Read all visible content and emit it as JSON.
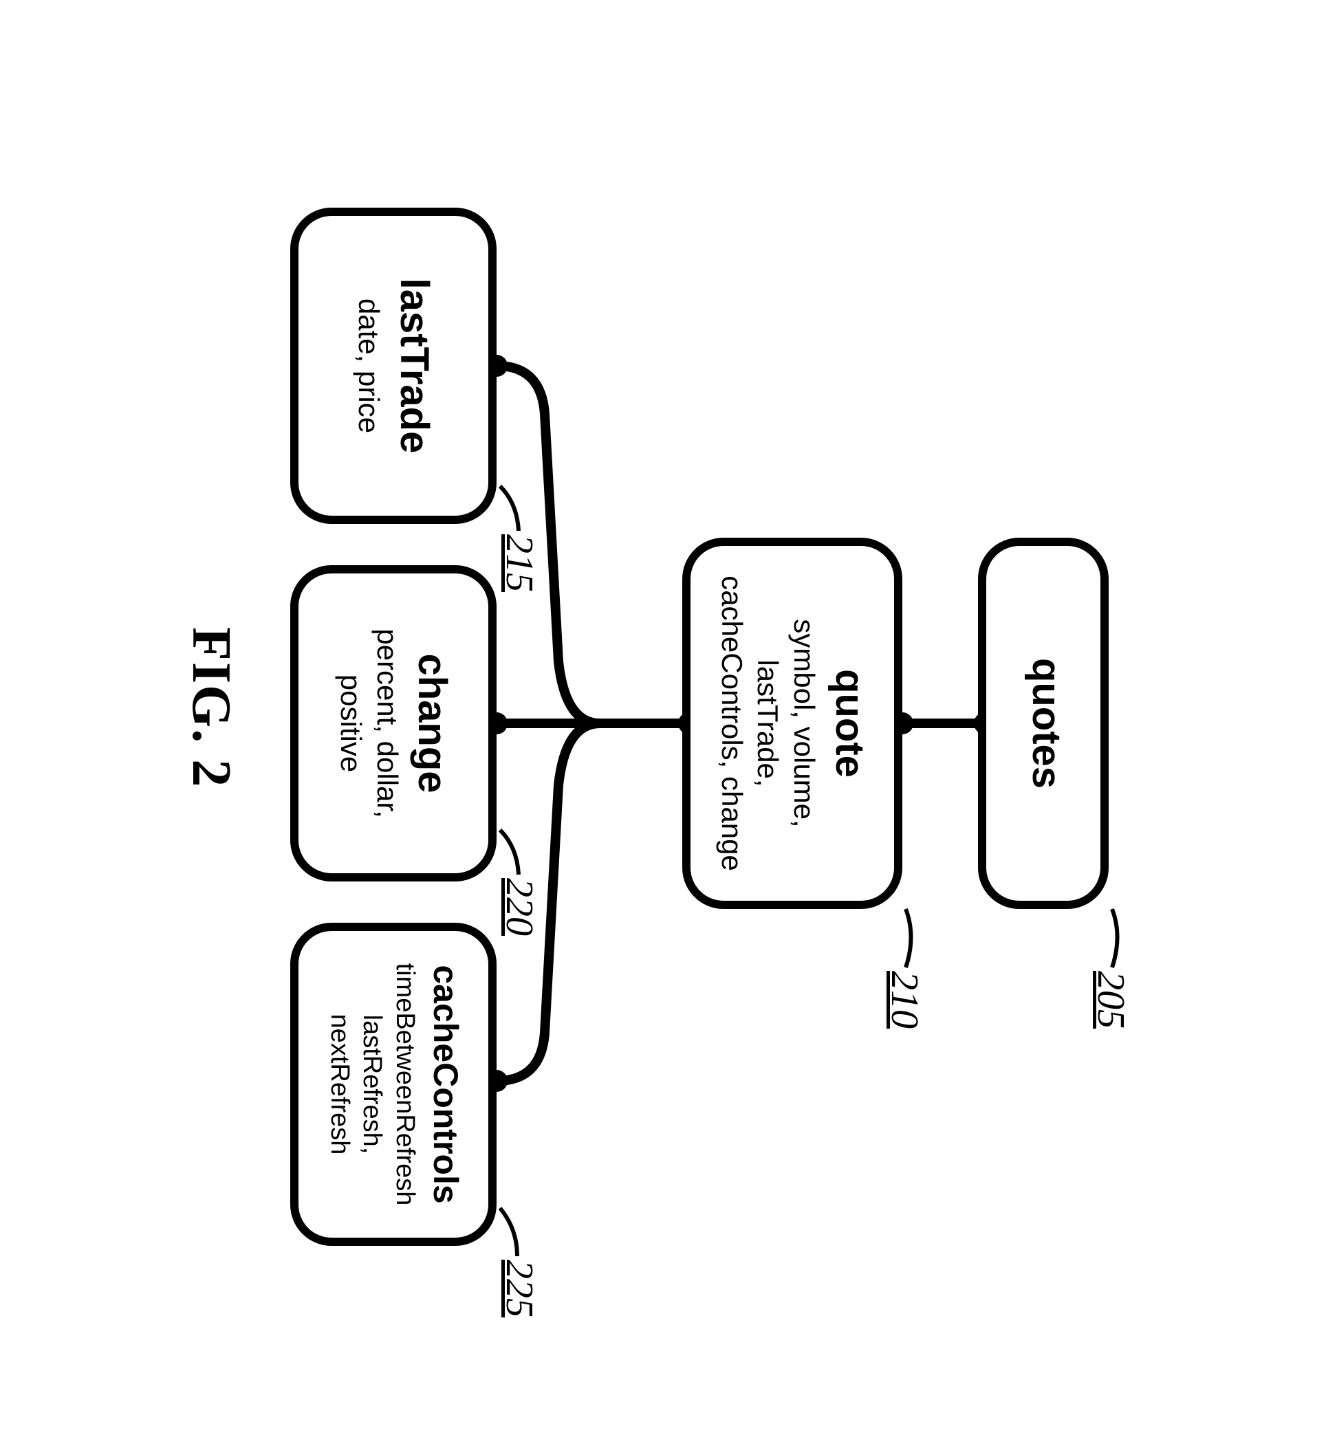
{
  "figure_label": "FIG. 2",
  "nodes": {
    "quotes": {
      "ref": "205",
      "title": "quotes",
      "attrs": ""
    },
    "quote": {
      "ref": "210",
      "title": "quote",
      "attrs": "symbol, volume,\nlastTrade,\ncacheControls, change"
    },
    "lastTrade": {
      "ref": "215",
      "title": "lastTrade",
      "attrs": "date, price"
    },
    "change": {
      "ref": "220",
      "title": "change",
      "attrs": "percent, dollar,\npositive"
    },
    "cache": {
      "ref": "225",
      "title": "cacheControls",
      "attrs": "timeBetweenRefresh\nlastRefresh,\nnextRefresh"
    }
  }
}
